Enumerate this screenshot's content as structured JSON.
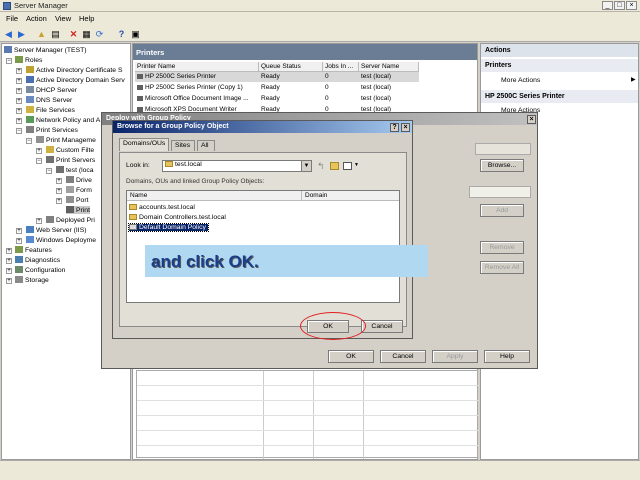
{
  "window": {
    "title": "Server Manager"
  },
  "menu": [
    "File",
    "Action",
    "View",
    "Help"
  ],
  "tree": [
    {
      "label": "Server Manager (TEST)",
      "depth": 0
    },
    {
      "label": "Roles",
      "depth": 1
    },
    {
      "label": "Active Directory Certificate S",
      "depth": 2
    },
    {
      "label": "Active Directory Domain Serv",
      "depth": 2
    },
    {
      "label": "DHCP Server",
      "depth": 2
    },
    {
      "label": "DNS Server",
      "depth": 2
    },
    {
      "label": "File Services",
      "depth": 2
    },
    {
      "label": "Network Policy and A",
      "depth": 2
    },
    {
      "label": "Print Services",
      "depth": 2
    },
    {
      "label": "Print Manageme",
      "depth": 3
    },
    {
      "label": "Custom Filte",
      "depth": 4
    },
    {
      "label": "Print Servers",
      "depth": 4
    },
    {
      "label": "test (loca",
      "depth": 5
    },
    {
      "label": "Drive",
      "depth": 6
    },
    {
      "label": "Form",
      "depth": 6
    },
    {
      "label": "Port",
      "depth": 6
    },
    {
      "label": "Print",
      "depth": 6
    },
    {
      "label": "Deployed Pri",
      "depth": 4
    },
    {
      "label": "Web Server (IIS)",
      "depth": 2
    },
    {
      "label": "Windows Deployme",
      "depth": 2
    },
    {
      "label": "Features",
      "depth": 1
    },
    {
      "label": "Diagnostics",
      "depth": 1
    },
    {
      "label": "Configuration",
      "depth": 1
    },
    {
      "label": "Storage",
      "depth": 1
    }
  ],
  "printers": {
    "header": "Printers",
    "columns": [
      "Printer Name",
      "Queue Status",
      "Jobs In ...",
      "Server Name"
    ],
    "rows": [
      [
        "HP 2500C Series Printer",
        "Ready",
        "0",
        "test (local)"
      ],
      [
        "HP 2500C Series Printer (Copy 1)",
        "Ready",
        "0",
        "test (local)"
      ],
      [
        "Microsoft Office Document Image ...",
        "Ready",
        "0",
        "test (local)"
      ],
      [
        "Microsoft XPS Document Writer",
        "Ready",
        "0",
        "test (local)"
      ]
    ]
  },
  "actions": {
    "header": "Actions",
    "section1": "Printers",
    "item1": "More Actions",
    "section2": "HP 2500C Series Printer",
    "item2": "More Actions"
  },
  "deploy": {
    "title": "Deploy with Group Policy",
    "buttons": {
      "browse": "Browse...",
      "add": "Add",
      "remove": "Remove",
      "remove_all": "Remove All",
      "ok": "OK",
      "cancel": "Cancel",
      "apply": "Apply",
      "help": "Help"
    }
  },
  "browse": {
    "title": "Browse for a Group Policy Object",
    "tabs": [
      "Domains/OUs",
      "Sites",
      "All"
    ],
    "look_in_label": "Look in:",
    "look_in_value": "test.local",
    "list_caption": "Domains, OUs and linked Group Policy Objects:",
    "columns": [
      "Name",
      "Domain"
    ],
    "items": [
      "accounts.test.local",
      "Domain Controllers.test.local",
      "Default Domain Policy"
    ],
    "ok": "OK",
    "cancel": "Cancel"
  },
  "callout": {
    "prefix": "and click ",
    "emphasis": "OK."
  }
}
